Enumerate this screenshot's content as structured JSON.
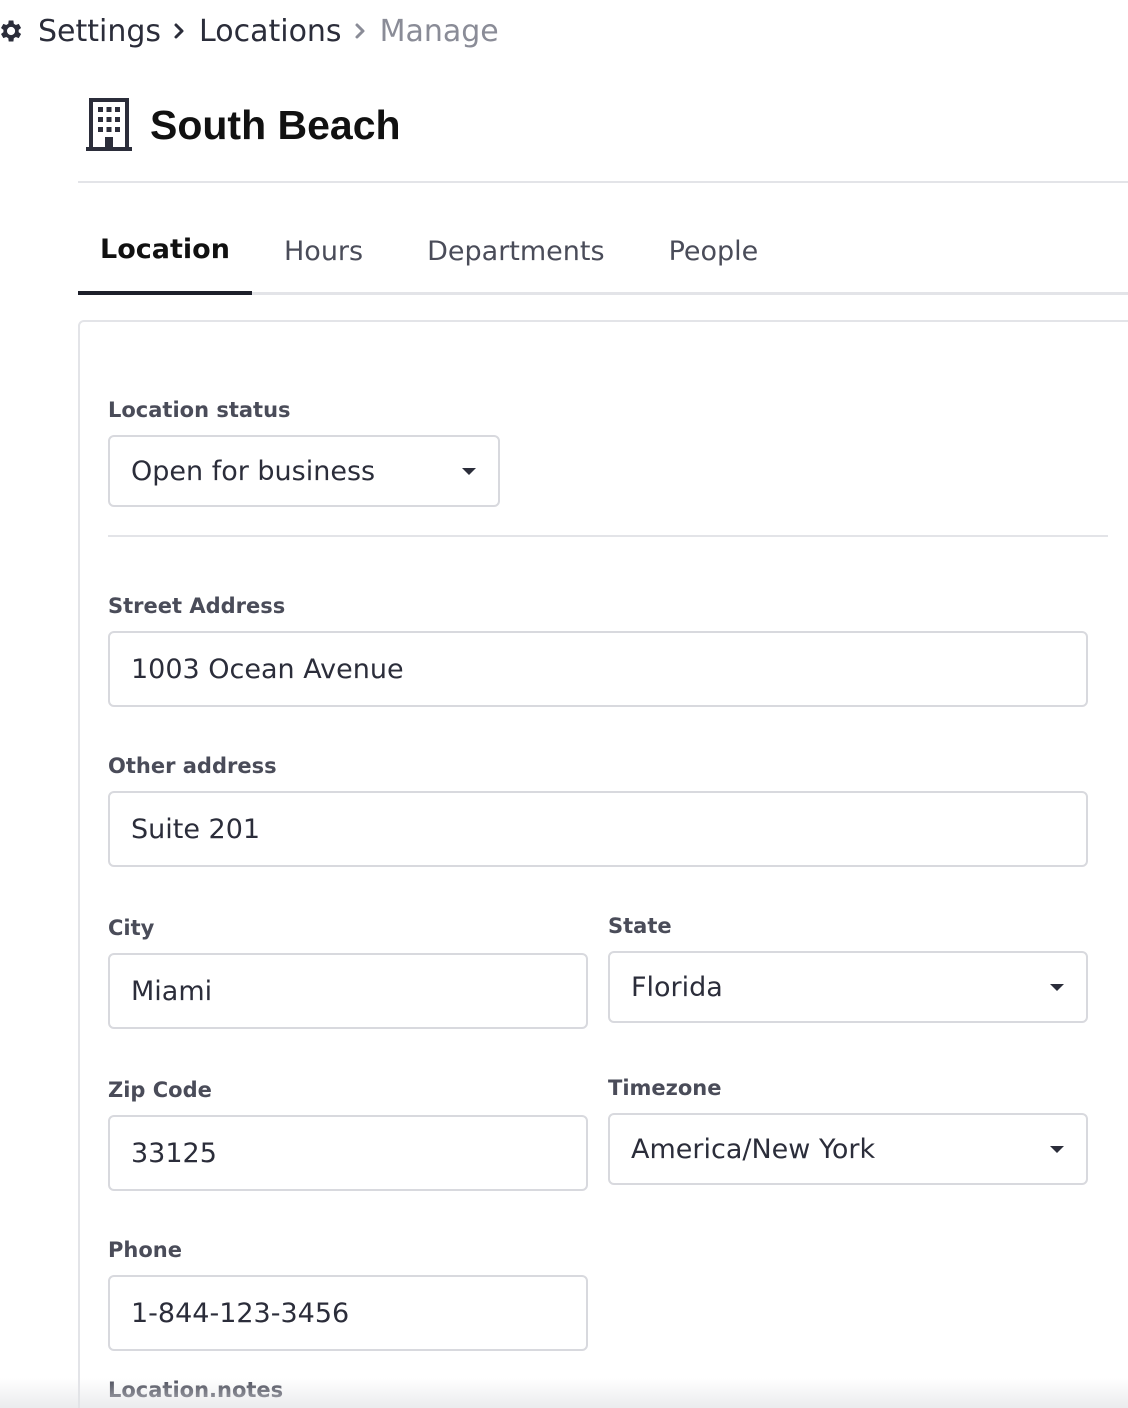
{
  "breadcrumb": {
    "icon": "gear-icon",
    "items": [
      "Settings",
      "Locations",
      "Manage"
    ]
  },
  "header": {
    "icon": "building-icon",
    "title": "South Beach"
  },
  "tabs": [
    {
      "label": "Location",
      "active": true
    },
    {
      "label": "Hours",
      "active": false
    },
    {
      "label": "Departments",
      "active": false
    },
    {
      "label": "People",
      "active": false
    }
  ],
  "form": {
    "status": {
      "label": "Location status",
      "value": "Open for business"
    },
    "street": {
      "label": "Street Address",
      "value": "1003 Ocean Avenue"
    },
    "other": {
      "label": "Other address",
      "value": "Suite 201"
    },
    "city": {
      "label": "City",
      "value": "Miami"
    },
    "state": {
      "label": "State",
      "value": "Florida"
    },
    "zip": {
      "label": "Zip Code",
      "value": "33125"
    },
    "timezone": {
      "label": "Timezone",
      "value": "America/New York"
    },
    "phone": {
      "label": "Phone",
      "value": "1-844-123-3456"
    },
    "notes": {
      "label": "Location.notes"
    }
  },
  "colors": {
    "text": "#2b2d3a",
    "muted": "#8a8c97",
    "border": "#d8d9de",
    "divider": "#e3e4e8",
    "active_tab": "#1d1f2a"
  }
}
